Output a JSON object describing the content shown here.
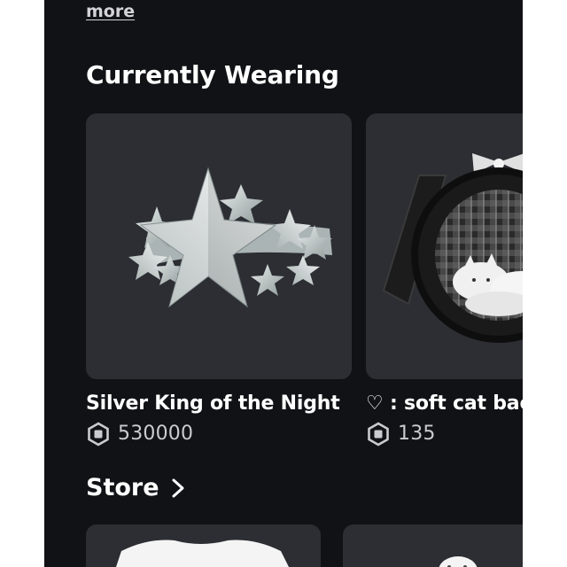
{
  "description_section": {
    "more_label": "more"
  },
  "currently_wearing": {
    "title": "Currently Wearing",
    "items": [
      {
        "name": "Silver King of the Night",
        "price": "530000",
        "icon": "silver-star-crown-thumbnail"
      },
      {
        "name": "♡ : soft cat bac",
        "price": "135",
        "icon": "soft-cat-backpack-thumbnail"
      }
    ]
  },
  "store": {
    "title": "Store",
    "chevron_icon": "chevron-right-icon"
  },
  "colors": {
    "background": "#111216",
    "card": "#2c2e33",
    "text": "#ffffff",
    "price_text": "#c9cbd1"
  }
}
